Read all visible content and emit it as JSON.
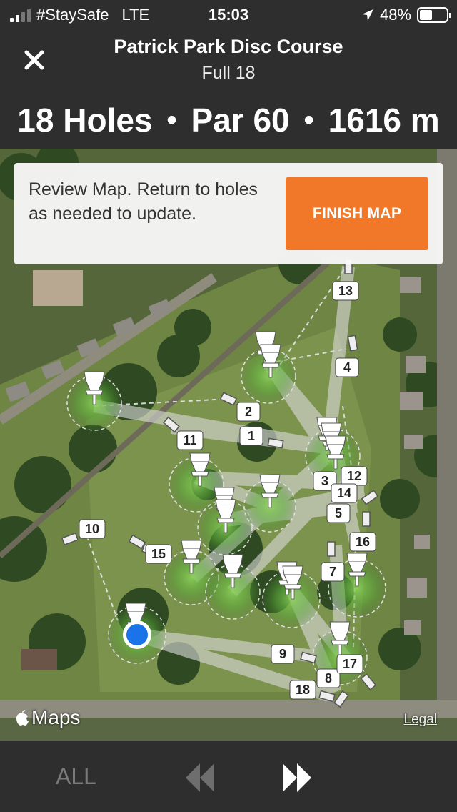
{
  "status": {
    "carrier": "#StaySafe",
    "network": "LTE",
    "time": "15:03",
    "battery": "48%",
    "battery_level": 0.48
  },
  "nav": {
    "title": "Patrick Park Disc Course",
    "subtitle": "Full 18"
  },
  "summary": {
    "holes": "18 Holes",
    "par": "Par 60",
    "distance": "1616 m"
  },
  "card": {
    "message": "Review Map. Return to holes as needed to update.",
    "button": "FINISH MAP"
  },
  "map": {
    "brand": "Maps",
    "legal": "Legal",
    "hole_labels": [
      "1",
      "2",
      "3",
      "4",
      "5",
      "7",
      "8",
      "9",
      "10",
      "11",
      "12",
      "13",
      "14",
      "15",
      "16",
      "17",
      "18"
    ]
  },
  "bottom": {
    "all": "ALL"
  },
  "colors": {
    "accent": "#f07828",
    "bar": "#2e2e2e",
    "location": "#1a73e8"
  }
}
